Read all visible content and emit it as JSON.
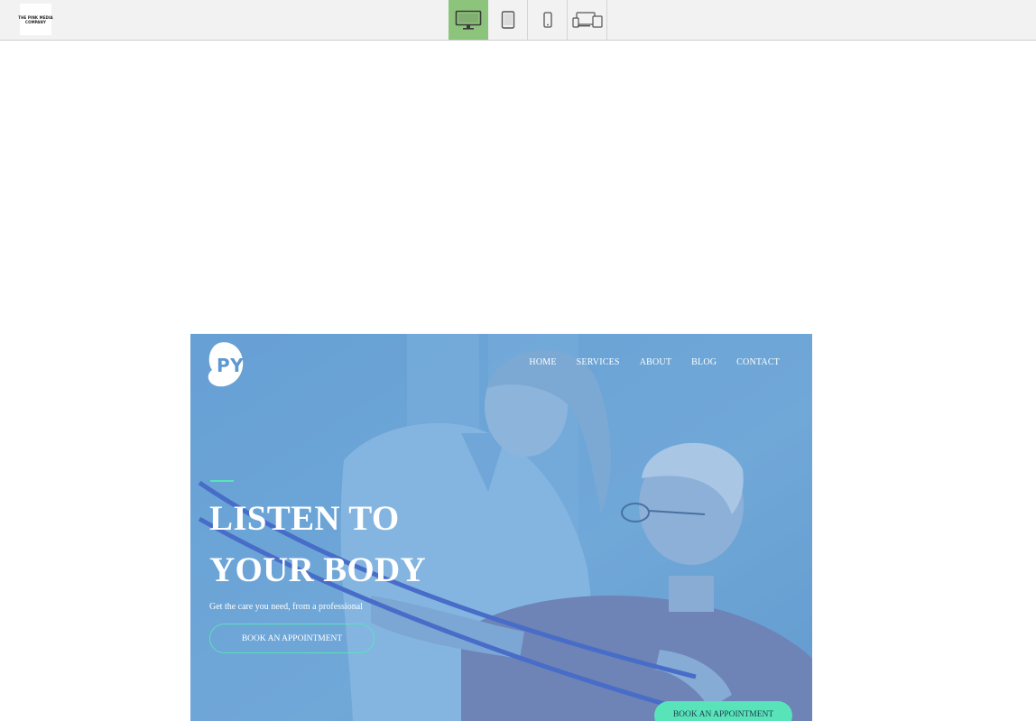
{
  "toolbar": {
    "brand": {
      "line1": "THE PINK MEDIA",
      "line2": "COMPANY"
    },
    "devices": [
      {
        "label": "Desktop",
        "icon": "desktop-icon",
        "active": true
      },
      {
        "label": "Tablet",
        "icon": "tablet-icon",
        "active": false
      },
      {
        "label": "Mobile",
        "icon": "mobile-icon",
        "active": false
      },
      {
        "label": "All devices",
        "icon": "responsive-icon",
        "active": false
      }
    ],
    "active_color": "#8dc47b"
  },
  "preview": {
    "logo_text": "PY",
    "nav": [
      "HOME",
      "SERVICES",
      "ABOUT",
      "BLOG",
      "CONTACT"
    ],
    "hero": {
      "title_line1": "LISTEN TO",
      "title_line2": "YOUR BODY",
      "subtitle": "Get the care you need, from a professional",
      "cta_outline": "BOOK AN APPOINTMENT",
      "cta_solid": "BOOK AN APPOINTMENT"
    },
    "accent_color": "#58e3b9",
    "overlay_color": "#6fa6d4"
  }
}
